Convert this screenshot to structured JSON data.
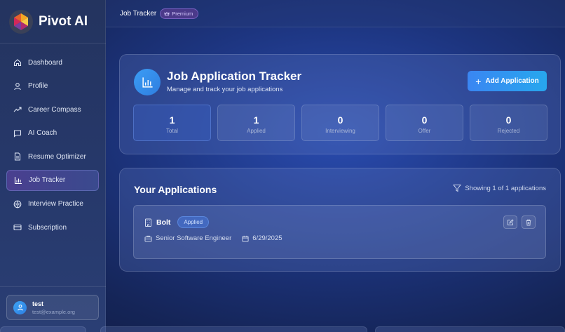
{
  "app": {
    "name": "Pivot AI",
    "accent": "#3a86f2",
    "active_color": "#4a3f8f"
  },
  "sidebar": {
    "items": [
      {
        "label": "Dashboard",
        "icon": "home-icon"
      },
      {
        "label": "Profile",
        "icon": "user-icon"
      },
      {
        "label": "Career Compass",
        "icon": "trending-up-icon"
      },
      {
        "label": "AI Coach",
        "icon": "chat-icon"
      },
      {
        "label": "Resume Optimizer",
        "icon": "document-icon"
      },
      {
        "label": "Job Tracker",
        "icon": "bar-chart-icon",
        "active": true
      },
      {
        "label": "Interview Practice",
        "icon": "brain-icon"
      },
      {
        "label": "Subscription",
        "icon": "credit-card-icon"
      }
    ],
    "user": {
      "name": "test",
      "email": "test@example.org"
    }
  },
  "topbar": {
    "breadcrumb": "Job Tracker",
    "badge": "Premium"
  },
  "tracker": {
    "title": "Job Application Tracker",
    "subtitle": "Manage and track your job applications",
    "add_button": "Add Application",
    "stats": [
      {
        "value": "1",
        "label": "Total"
      },
      {
        "value": "1",
        "label": "Applied"
      },
      {
        "value": "0",
        "label": "Interviewing"
      },
      {
        "value": "0",
        "label": "Offer"
      },
      {
        "value": "0",
        "label": "Rejected"
      }
    ]
  },
  "applications": {
    "title": "Your Applications",
    "showing": "Showing 1 of 1 applications",
    "items": [
      {
        "company": "Bolt",
        "status": "Applied",
        "position": "Senior Software Engineer",
        "date": "6/29/2025"
      }
    ]
  }
}
